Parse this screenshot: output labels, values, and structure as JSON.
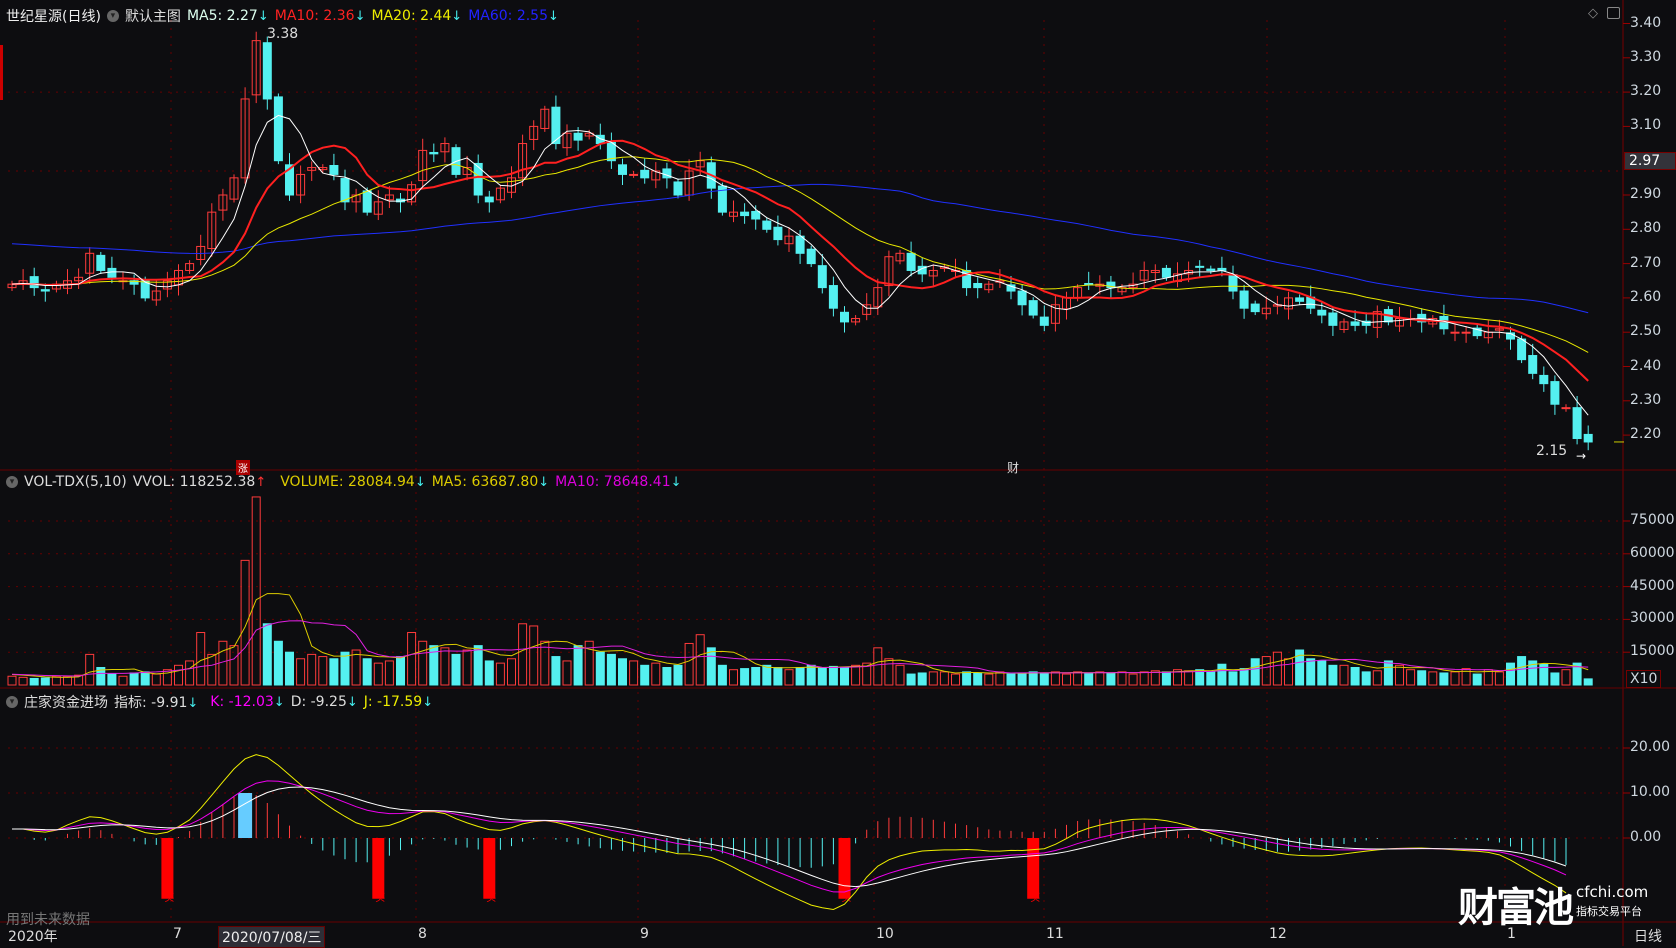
{
  "header": {
    "title": "世纪星源(日线)",
    "main_chart": "默认主图",
    "ma5": "MA5: 2.27",
    "ma10": "MA10: 2.36",
    "ma20": "MA20: 2.44",
    "ma60": "MA60: 2.55"
  },
  "volume_header": {
    "name": "VOL-TDX(5,10)",
    "vvol": "VVOL: 118252.38",
    "volume": "VOLUME: 28084.94",
    "ma5": "MA5: 63687.80",
    "ma10": "MA10: 78648.41",
    "multiplier": "X10"
  },
  "indicator_header": {
    "name": "庄家资金进场",
    "index": "指标: -9.91",
    "k": "K: -12.03",
    "d": "D: -9.25",
    "j": "J: -17.59"
  },
  "price_axis": [
    "3.40",
    "3.30",
    "3.20",
    "3.10",
    "2.90",
    "2.80",
    "2.70",
    "2.60",
    "2.50",
    "2.40",
    "2.30",
    "2.20"
  ],
  "current_price": "2.97",
  "high_label": "3.38",
  "low_label": "2.15",
  "volume_axis": [
    "75000",
    "60000",
    "45000",
    "30000",
    "15000"
  ],
  "indicator_axis": [
    "20.00",
    "10.00",
    "0.00"
  ],
  "markers": {
    "rise": "涨",
    "finance": "财",
    "buy": "买"
  },
  "future_data_note": "用到未来数据",
  "time_axis": {
    "year": "2020年",
    "cursor_date": "2020/07/08/三",
    "months": [
      "7",
      "8",
      "9",
      "10",
      "11",
      "12",
      "1"
    ],
    "period": "日线"
  },
  "watermark": {
    "brand": "财富池",
    "site": "cfchi.com",
    "slogan": "指标交易平台"
  },
  "colors": {
    "up": "#ff3b3b",
    "down": "#54f0f0",
    "ma5": "#ffffff",
    "ma10": "#ff2020",
    "ma20": "#e8e800",
    "ma60": "#2030ff",
    "vma10": "#e020e0"
  },
  "chart_data": {
    "type": "candlestick",
    "closes": [
      2.64,
      2.65,
      2.63,
      2.62,
      2.64,
      2.65,
      2.66,
      2.73,
      2.68,
      2.66,
      2.65,
      2.64,
      2.6,
      2.62,
      2.65,
      2.68,
      2.7,
      2.75,
      2.85,
      2.9,
      2.95,
      3.18,
      3.35,
      3.18,
      3.0,
      2.9,
      2.96,
      2.98,
      2.98,
      2.96,
      2.88,
      2.9,
      2.85,
      2.88,
      2.9,
      2.88,
      2.93,
      3.03,
      3.02,
      3.05,
      2.96,
      2.98,
      2.9,
      2.88,
      2.92,
      2.95,
      3.05,
      3.1,
      3.15,
      3.05,
      3.08,
      3.06,
      3.08,
      3.05,
      3.0,
      2.96,
      2.96,
      2.95,
      2.97,
      2.95,
      2.9,
      2.97,
      3.0,
      2.92,
      2.85,
      2.85,
      2.84,
      2.83,
      2.8,
      2.77,
      2.78,
      2.73,
      2.7,
      2.63,
      2.57,
      2.53,
      2.54,
      2.58,
      2.63,
      2.72,
      2.73,
      2.68,
      2.67,
      2.68,
      2.69,
      2.68,
      2.63,
      2.63,
      2.64,
      2.65,
      2.62,
      2.58,
      2.55,
      2.52,
      2.58,
      2.6,
      2.63,
      2.64,
      2.64,
      2.63,
      2.63,
      2.64,
      2.68,
      2.68,
      2.66,
      2.67,
      2.68,
      2.69,
      2.68,
      2.68,
      2.62,
      2.57,
      2.56,
      2.57,
      2.58,
      2.6,
      2.59,
      2.57,
      2.55,
      2.52,
      2.53,
      2.52,
      2.52,
      2.56,
      2.53,
      2.54,
      2.54,
      2.53,
      2.54,
      2.51,
      2.5,
      2.5,
      2.49,
      2.5,
      2.51,
      2.48,
      2.42,
      2.38,
      2.35,
      2.29,
      2.28,
      2.19,
      2.18
    ],
    "volumes": [
      4000,
      3500,
      3000,
      3200,
      4000,
      3800,
      4500,
      14000,
      8000,
      5000,
      4000,
      5500,
      6000,
      5000,
      7000,
      9000,
      11000,
      24000,
      14000,
      20000,
      18000,
      57000,
      86000,
      28000,
      20000,
      15000,
      12000,
      14000,
      13000,
      12000,
      15000,
      16000,
      12000,
      10000,
      11000,
      13000,
      24000,
      20000,
      18000,
      17000,
      14000,
      16000,
      18000,
      11000,
      10000,
      12000,
      28000,
      27000,
      20000,
      13000,
      11000,
      18000,
      20000,
      15000,
      14000,
      12000,
      11000,
      9000,
      10000,
      8000,
      9000,
      19000,
      23000,
      17000,
      9000,
      7000,
      7500,
      8000,
      9000,
      8000,
      7000,
      8000,
      9000,
      8000,
      8500,
      8000,
      9000,
      10000,
      17000,
      12000,
      9000,
      5000,
      5500,
      6000,
      6000,
      5000,
      6000,
      5500,
      5000,
      6000,
      5000,
      5500,
      6000,
      5500,
      6000,
      5000,
      6000,
      5500,
      6000,
      5500,
      6000,
      5000,
      6000,
      6500,
      6000,
      7000,
      6500,
      7000,
      6000,
      9500,
      6000,
      7500,
      12000,
      13000,
      15000,
      12000,
      16000,
      12000,
      11000,
      9000,
      9000,
      8000,
      6000,
      6500,
      11000,
      9000,
      7000,
      6500,
      6000,
      5500,
      6000,
      7500,
      5000,
      7000,
      6000,
      10000,
      13000,
      11000,
      9500,
      5500,
      7000,
      10000,
      2800
    ],
    "indicator": [
      2,
      2,
      1.5,
      1.5,
      2,
      3,
      3.5,
      4,
      3.5,
      3,
      2.5,
      2,
      1.5,
      1.5,
      2,
      3,
      4,
      6,
      8,
      10,
      12,
      13.5,
      14,
      13.5,
      12.5,
      11.5,
      10.5,
      9.5,
      8.5,
      7.5,
      6.5,
      5.5,
      5,
      5,
      5,
      5.5,
      6,
      6.5,
      6,
      5.5,
      4.5,
      4,
      3.5,
      3,
      3,
      3.5,
      4,
      4,
      4,
      3.5,
      3,
      2.5,
      2,
      1.5,
      1,
      0.5,
      0,
      -0.5,
      -1,
      -1.5,
      -2,
      -2,
      -2.5,
      -3,
      -4,
      -5,
      -6,
      -7,
      -8,
      -9,
      -10,
      -11,
      -12,
      -12.5,
      -13,
      -12,
      -10,
      -8,
      -7,
      -6.5,
      -6,
      -5.5,
      -5,
      -4.8,
      -4.5,
      -4.3,
      -4,
      -4,
      -4,
      -3.8,
      -3.5,
      -3.5,
      -3.2,
      -3,
      -2,
      -1,
      0,
      0.5,
      1,
      1.5,
      2,
      2.3,
      2.5,
      2.6,
      2.5,
      2.3,
      2,
      1.5,
      1,
      0.5,
      0,
      -0.5,
      -1,
      -1.5,
      -2,
      -2.3,
      -2.5,
      -2.7,
      -2.8,
      -2.8,
      -2.7,
      -2.6,
      -2.5,
      -2.4,
      -2.3,
      -2.3,
      -2.3,
      -2.3,
      -2.4,
      -2.5,
      -2.6,
      -2.7,
      -2.8,
      -3,
      -3.5,
      -4.5,
      -5.5,
      -6.5,
      -7.5,
      -8.5,
      -9.91
    ],
    "buy_signals": [
      14,
      33,
      43,
      75,
      92
    ],
    "highlight_bar": 21,
    "price_range": [
      2.1,
      3.45
    ],
    "volume_range": [
      0,
      90000
    ],
    "indicator_range": [
      -18,
      30
    ]
  }
}
